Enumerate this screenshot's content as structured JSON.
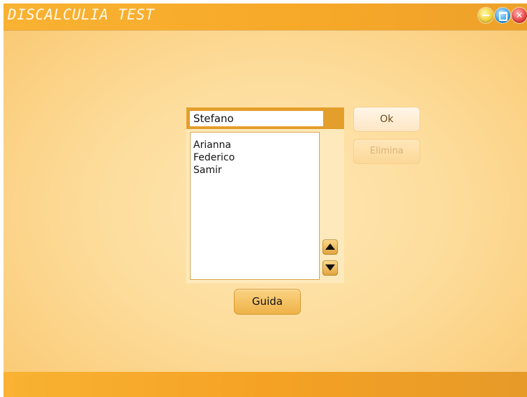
{
  "app": {
    "title": "DISCALCULIA TEST"
  },
  "window_controls": {
    "minimize": "minimize",
    "maximize": "maximize",
    "close": "close"
  },
  "user_select": {
    "input_value": "Stefano",
    "users": [
      "Arianna",
      "Federico",
      "Samir"
    ]
  },
  "buttons": {
    "ok": "Ok",
    "elimina": "Elimina",
    "guida": "Guida"
  },
  "colors": {
    "titlebar": "#f9b233",
    "background": "#fddd9c",
    "panel": "#e39e2b",
    "close": "#ea4444",
    "maximize": "#3aa4ec",
    "minimize": "#f3d23a"
  }
}
